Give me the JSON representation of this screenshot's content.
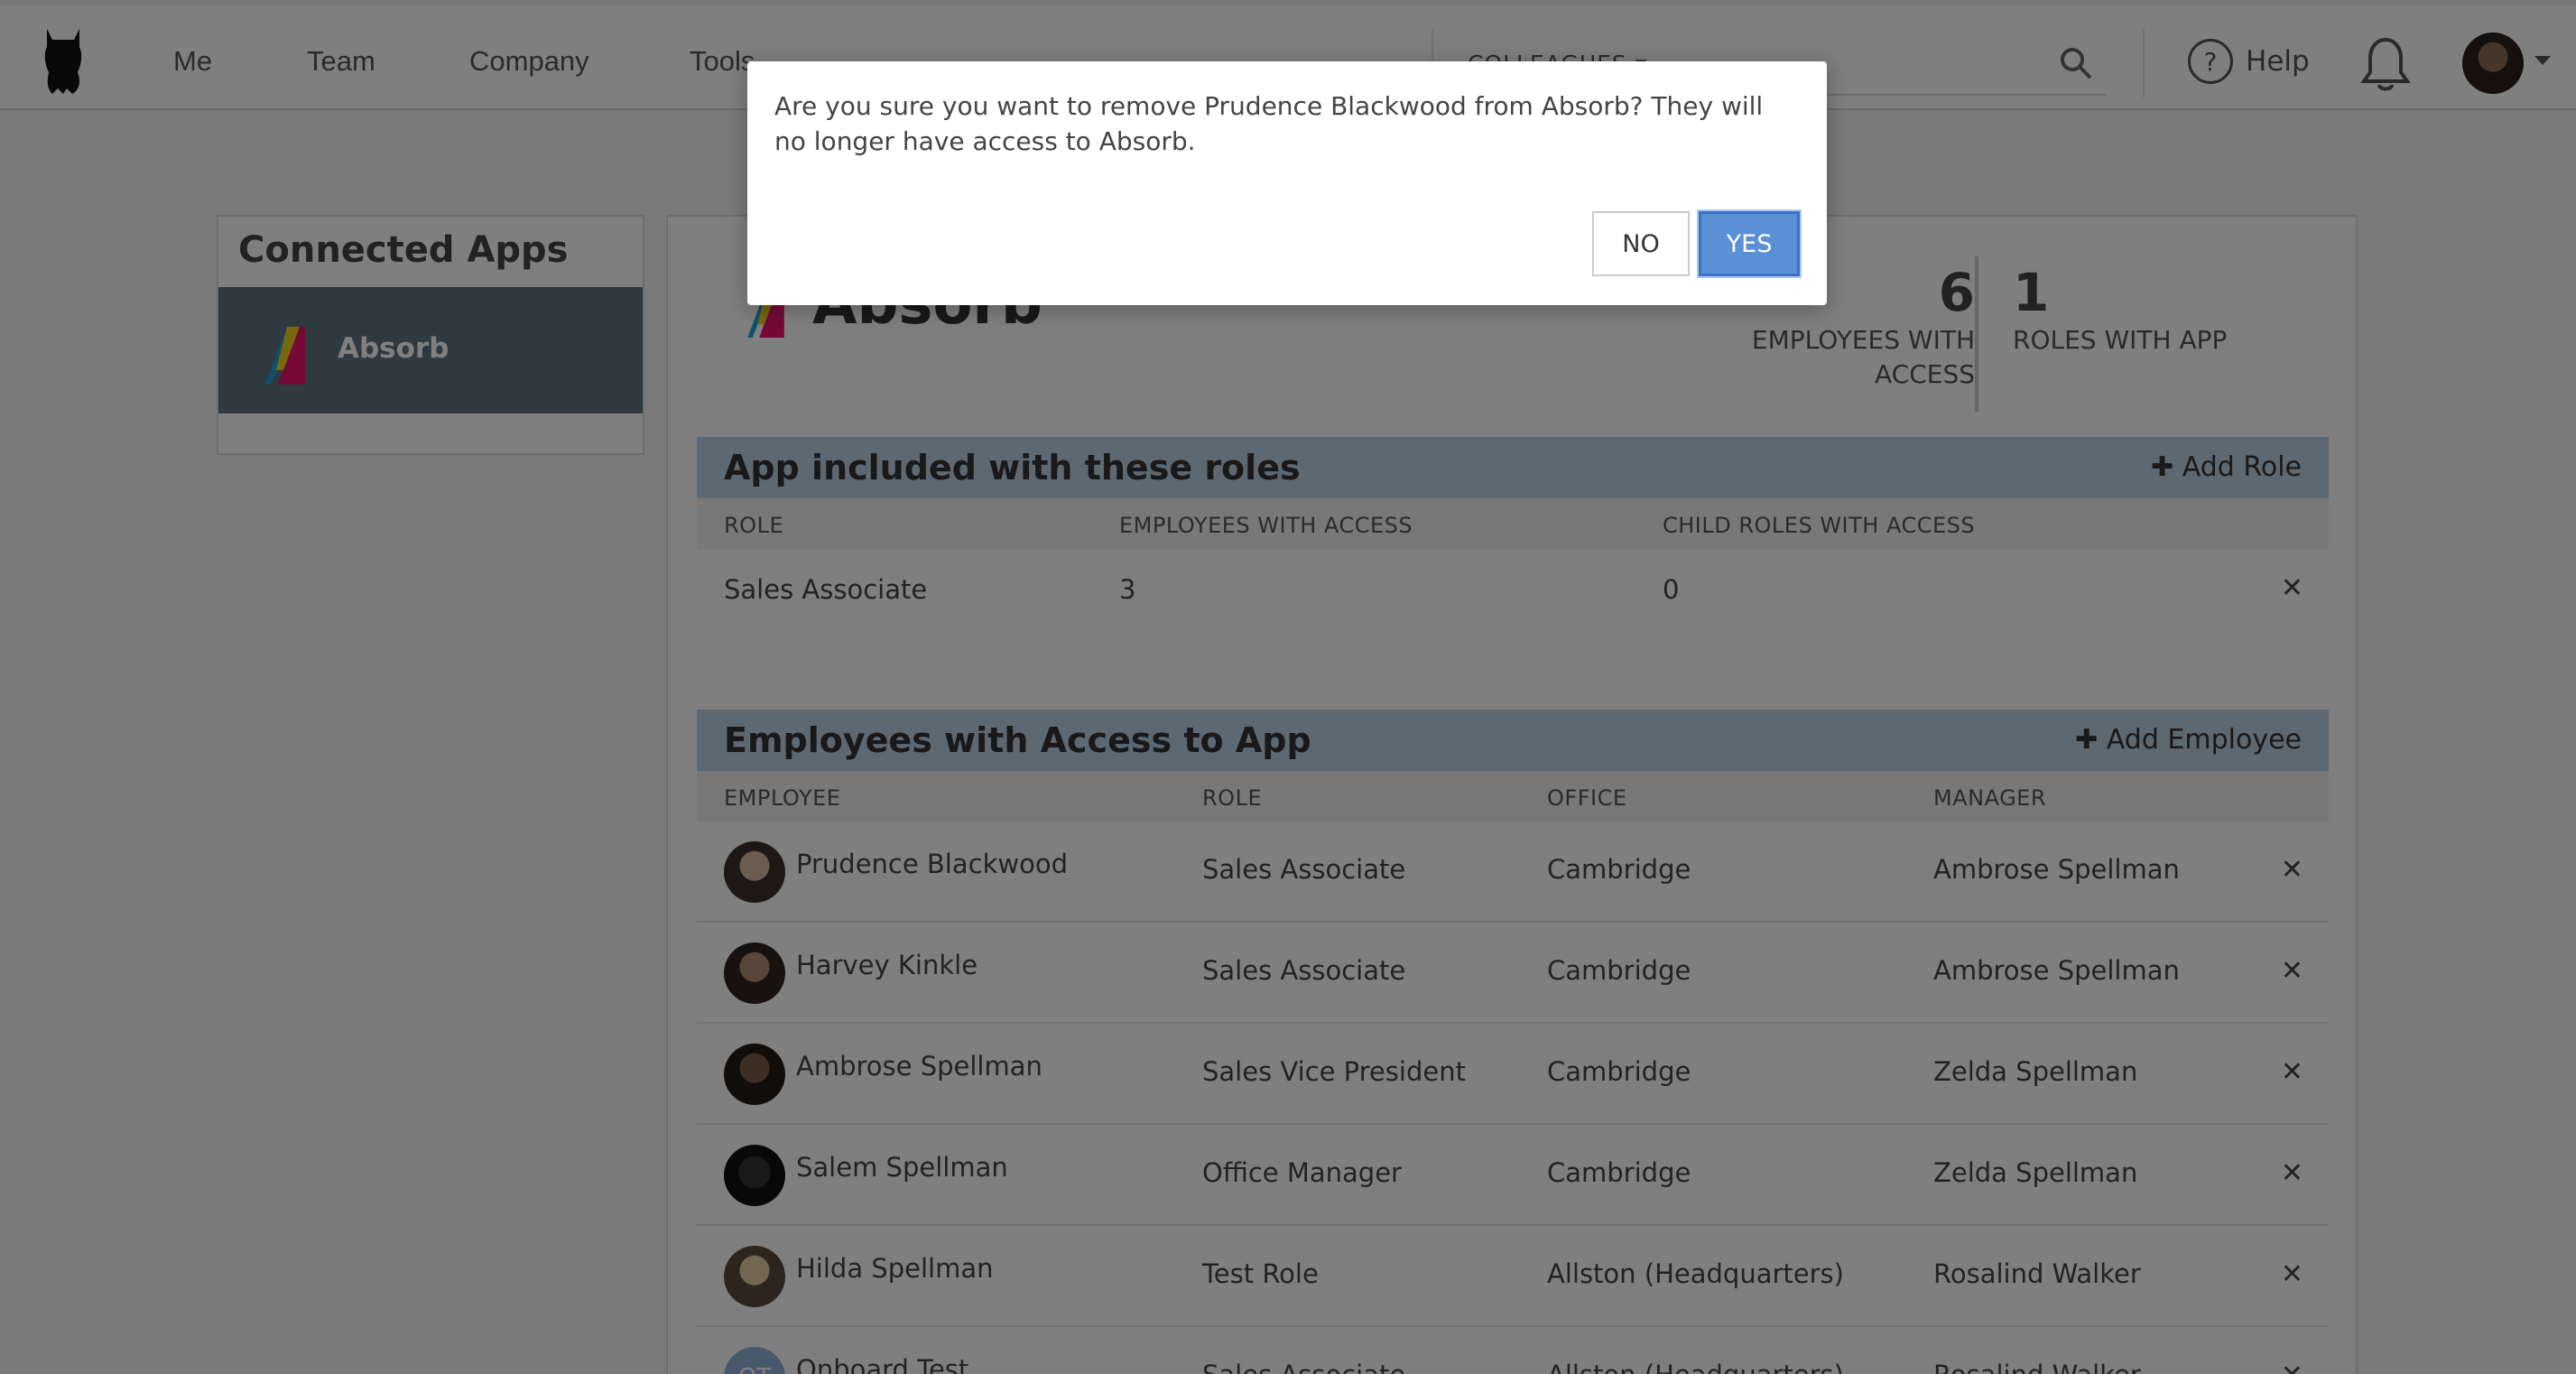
{
  "nav": {
    "items": [
      "Me",
      "Team",
      "Company",
      "Tools"
    ],
    "search_scope": "COLLEAGUES",
    "help_label": "Help"
  },
  "sidebar": {
    "title": "Connected Apps",
    "items": [
      {
        "label": "Absorb"
      }
    ]
  },
  "app": {
    "name": "Absorb",
    "stats": {
      "employees_count": "6",
      "employees_label_line1": "EMPLOYEES WITH",
      "employees_label_line2": "ACCESS",
      "roles_count": "1",
      "roles_label": "ROLES WITH APP"
    }
  },
  "roles_section": {
    "title": "App included with these roles",
    "action": "Add Role",
    "columns": [
      "ROLE",
      "EMPLOYEES WITH ACCESS",
      "CHILD ROLES WITH ACCESS"
    ],
    "rows": [
      {
        "role": "Sales Associate",
        "employees": "3",
        "child_roles": "0"
      }
    ]
  },
  "employees_section": {
    "title": "Employees with Access to App",
    "action": "Add Employee",
    "columns": [
      "EMPLOYEE",
      "ROLE",
      "OFFICE",
      "MANAGER"
    ],
    "rows": [
      {
        "name": "Prudence Blackwood",
        "role": "Sales Associate",
        "office": "Cambridge",
        "manager": "Ambrose Spellman"
      },
      {
        "name": "Harvey Kinkle",
        "role": "Sales Associate",
        "office": "Cambridge",
        "manager": "Ambrose Spellman"
      },
      {
        "name": "Ambrose Spellman",
        "role": "Sales Vice President",
        "office": "Cambridge",
        "manager": "Zelda Spellman"
      },
      {
        "name": "Salem Spellman",
        "role": "Office Manager",
        "office": "Cambridge",
        "manager": "Zelda Spellman"
      },
      {
        "name": "Hilda Spellman",
        "role": "Test Role",
        "office": "Allston (Headquarters)",
        "manager": "Rosalind Walker"
      },
      {
        "name": "Onboard Test",
        "initials": "OT",
        "role": "Sales Associate",
        "office": "Allston (Headquarters)",
        "manager": "Rosalind Walker"
      }
    ]
  },
  "modal": {
    "message": "Are you sure you want to remove Prudence Blackwood from Absorb? They will no longer have access to Absorb.",
    "no_label": "NO",
    "yes_label": "YES"
  },
  "colors": {
    "section_header": "#b9d0e4",
    "sidebar_active": "#5e7580",
    "primary_button": "#5b8fd6"
  }
}
